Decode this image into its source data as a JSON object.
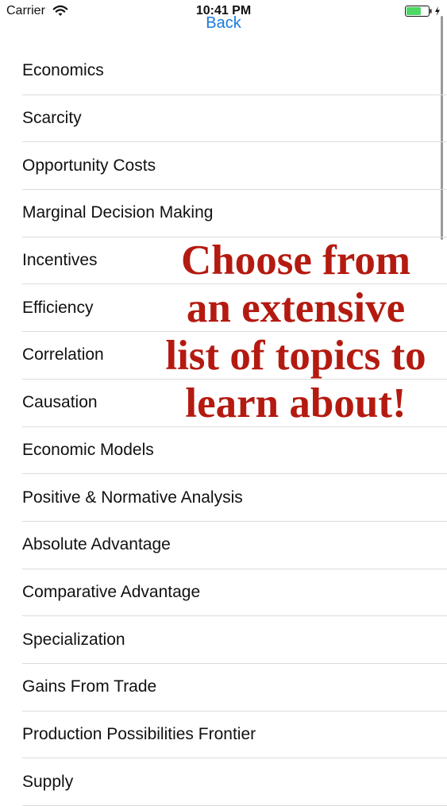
{
  "status_bar": {
    "carrier": "Carrier",
    "time": "10:41 PM",
    "battery_color": "#4cd964"
  },
  "nav": {
    "back_label": "Back",
    "accent_color": "#1a7ae0"
  },
  "topics": [
    "Economics",
    "Scarcity",
    "Opportunity Costs",
    "Marginal Decision Making",
    "Incentives",
    "Efficiency",
    "Correlation",
    "Causation",
    "Economic Models",
    "Positive & Normative Analysis",
    "Absolute Advantage",
    "Comparative Advantage",
    "Specialization",
    "Gains From Trade",
    "Production Possibilities Frontier",
    "Supply"
  ],
  "promo": {
    "lines": [
      "Choose from",
      "an extensive",
      "list of topics to",
      "learn about!"
    ],
    "color": "#b41a10"
  },
  "icons": {
    "wifi": "wifi-icon",
    "battery": "battery-icon",
    "charging": "charging-bolt-icon"
  }
}
